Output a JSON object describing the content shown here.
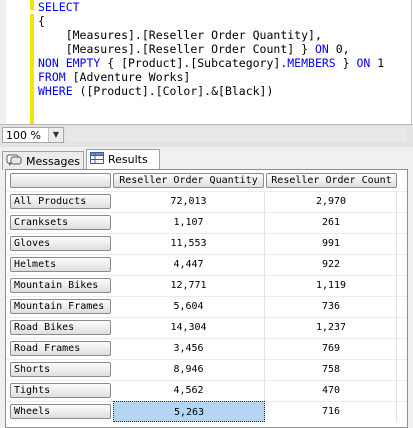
{
  "editor": {
    "lines": [
      {
        "parts": [
          [
            "kw",
            "SELECT"
          ]
        ]
      },
      {
        "parts": [
          [
            "br",
            "{"
          ]
        ]
      },
      {
        "parts": [
          [
            "br",
            "    [Measures].[Reseller Order Quantity],"
          ]
        ]
      },
      {
        "parts": [
          [
            "br",
            "    [Measures].[Reseller Order Count] } "
          ],
          [
            "kw",
            "ON"
          ],
          [
            "br",
            " 0,"
          ]
        ]
      },
      {
        "parts": [
          [
            "kw",
            "NON EMPTY"
          ],
          [
            "br",
            " { [Product].[Subcategory]."
          ],
          [
            "kw",
            "MEMBERS"
          ],
          [
            "br",
            " } "
          ],
          [
            "kw",
            "ON"
          ],
          [
            "br",
            " 1"
          ]
        ]
      },
      {
        "parts": [
          [
            "kw",
            "FROM"
          ],
          [
            "br",
            " [Adventure Works]"
          ]
        ]
      },
      {
        "parts": [
          [
            "kw",
            "WHERE"
          ],
          [
            "br",
            " ([Product].[Color].&[Black])"
          ]
        ]
      }
    ]
  },
  "zoom": {
    "value": "100 %"
  },
  "tabs": {
    "messages": "Messages",
    "results": "Results"
  },
  "grid": {
    "columns": [
      "Reseller Order Quantity",
      "Reseller Order Count"
    ],
    "rows": [
      {
        "label": "All Products",
        "qty": "72,013",
        "count": "2,970"
      },
      {
        "label": "Cranksets",
        "qty": "1,107",
        "count": "261"
      },
      {
        "label": "Gloves",
        "qty": "11,553",
        "count": "991"
      },
      {
        "label": "Helmets",
        "qty": "4,447",
        "count": "922"
      },
      {
        "label": "Mountain Bikes",
        "qty": "12,771",
        "count": "1,119"
      },
      {
        "label": "Mountain Frames",
        "qty": "5,604",
        "count": "736"
      },
      {
        "label": "Road Bikes",
        "qty": "14,304",
        "count": "1,237"
      },
      {
        "label": "Road Frames",
        "qty": "3,456",
        "count": "769"
      },
      {
        "label": "Shorts",
        "qty": "8,946",
        "count": "758"
      },
      {
        "label": "Tights",
        "qty": "4,562",
        "count": "470"
      },
      {
        "label": "Wheels",
        "qty": "5,263",
        "count": "716"
      }
    ],
    "selected_row": 10
  },
  "colors": {
    "keyword": "#0000ff",
    "selection": "#b4d5f3",
    "changebar": "#f2e600"
  }
}
